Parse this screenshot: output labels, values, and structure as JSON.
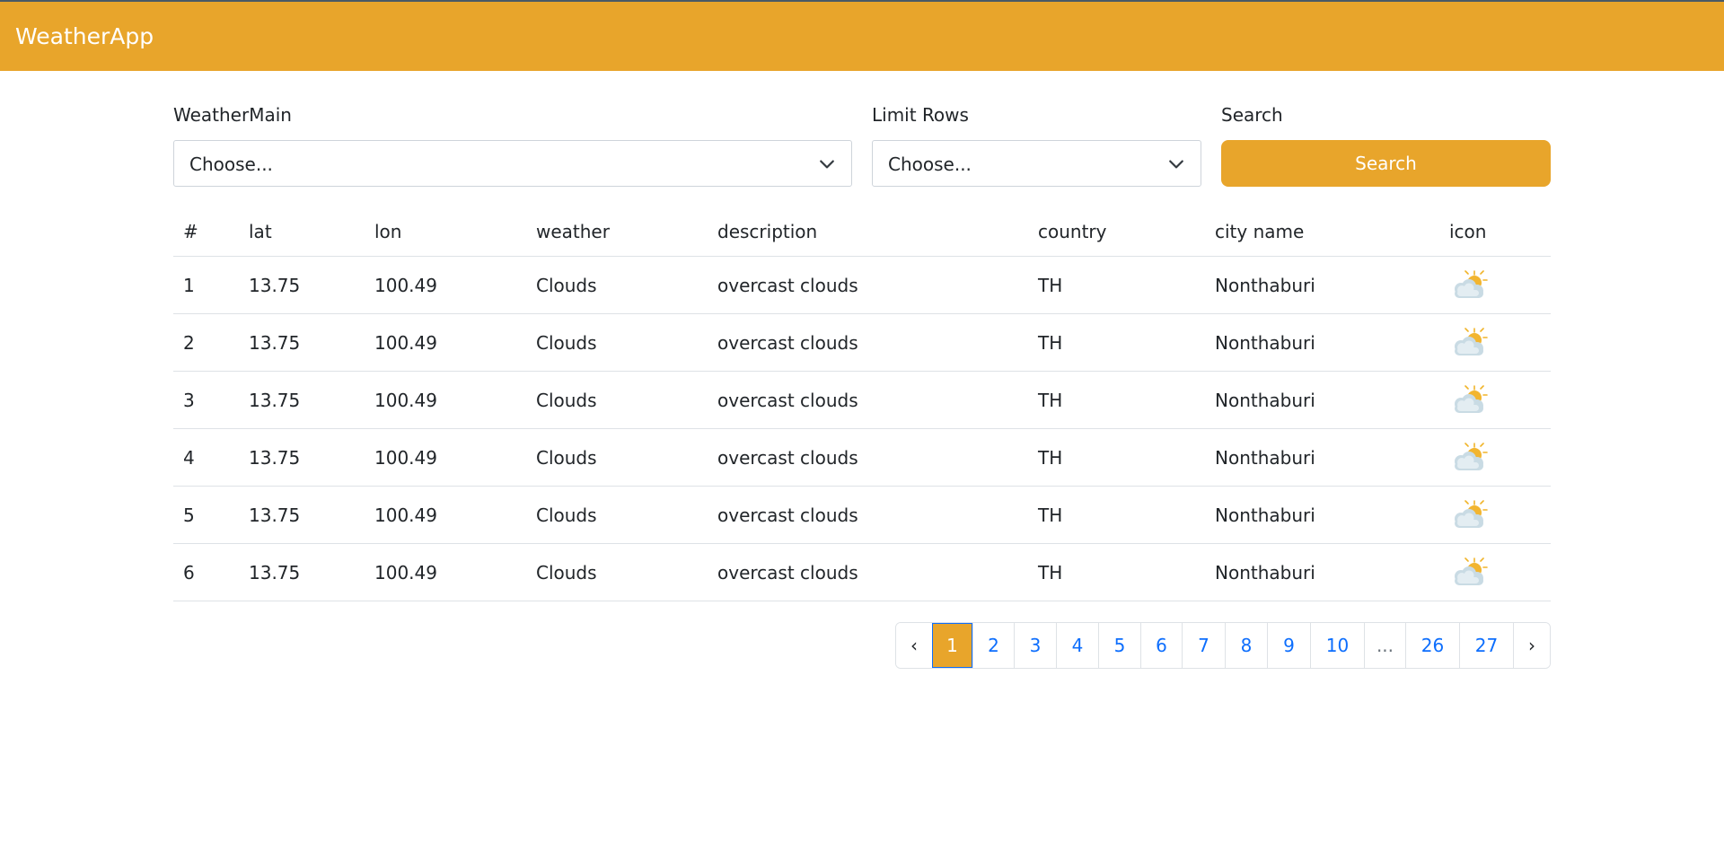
{
  "navbar": {
    "brand": "WeatherApp"
  },
  "filters": {
    "weather_main": {
      "label": "WeatherMain",
      "value": "Choose..."
    },
    "limit_rows": {
      "label": "Limit Rows",
      "value": "Choose..."
    },
    "search": {
      "label": "Search",
      "button_label": "Search"
    }
  },
  "table": {
    "headers": [
      "#",
      "lat",
      "lon",
      "weather",
      "description",
      "country",
      "city name",
      "icon"
    ],
    "rows": [
      {
        "num": "1",
        "lat": "13.75",
        "lon": "100.49",
        "weather": "Clouds",
        "description": "overcast clouds",
        "country": "TH",
        "city": "Nonthaburi",
        "icon": "partly-cloudy-icon"
      },
      {
        "num": "2",
        "lat": "13.75",
        "lon": "100.49",
        "weather": "Clouds",
        "description": "overcast clouds",
        "country": "TH",
        "city": "Nonthaburi",
        "icon": "partly-cloudy-icon"
      },
      {
        "num": "3",
        "lat": "13.75",
        "lon": "100.49",
        "weather": "Clouds",
        "description": "overcast clouds",
        "country": "TH",
        "city": "Nonthaburi",
        "icon": "partly-cloudy-icon"
      },
      {
        "num": "4",
        "lat": "13.75",
        "lon": "100.49",
        "weather": "Clouds",
        "description": "overcast clouds",
        "country": "TH",
        "city": "Nonthaburi",
        "icon": "partly-cloudy-icon"
      },
      {
        "num": "5",
        "lat": "13.75",
        "lon": "100.49",
        "weather": "Clouds",
        "description": "overcast clouds",
        "country": "TH",
        "city": "Nonthaburi",
        "icon": "partly-cloudy-icon"
      },
      {
        "num": "6",
        "lat": "13.75",
        "lon": "100.49",
        "weather": "Clouds",
        "description": "overcast clouds",
        "country": "TH",
        "city": "Nonthaburi",
        "icon": "partly-cloudy-icon"
      }
    ]
  },
  "pagination": {
    "prev": "‹",
    "next": "›",
    "pages": [
      "1",
      "2",
      "3",
      "4",
      "5",
      "6",
      "7",
      "8",
      "9",
      "10",
      "...",
      "26",
      "27"
    ],
    "active": "1"
  },
  "colors": {
    "brand": "#e8a52b",
    "link": "#0d6efd",
    "border": "#dee2e6"
  }
}
